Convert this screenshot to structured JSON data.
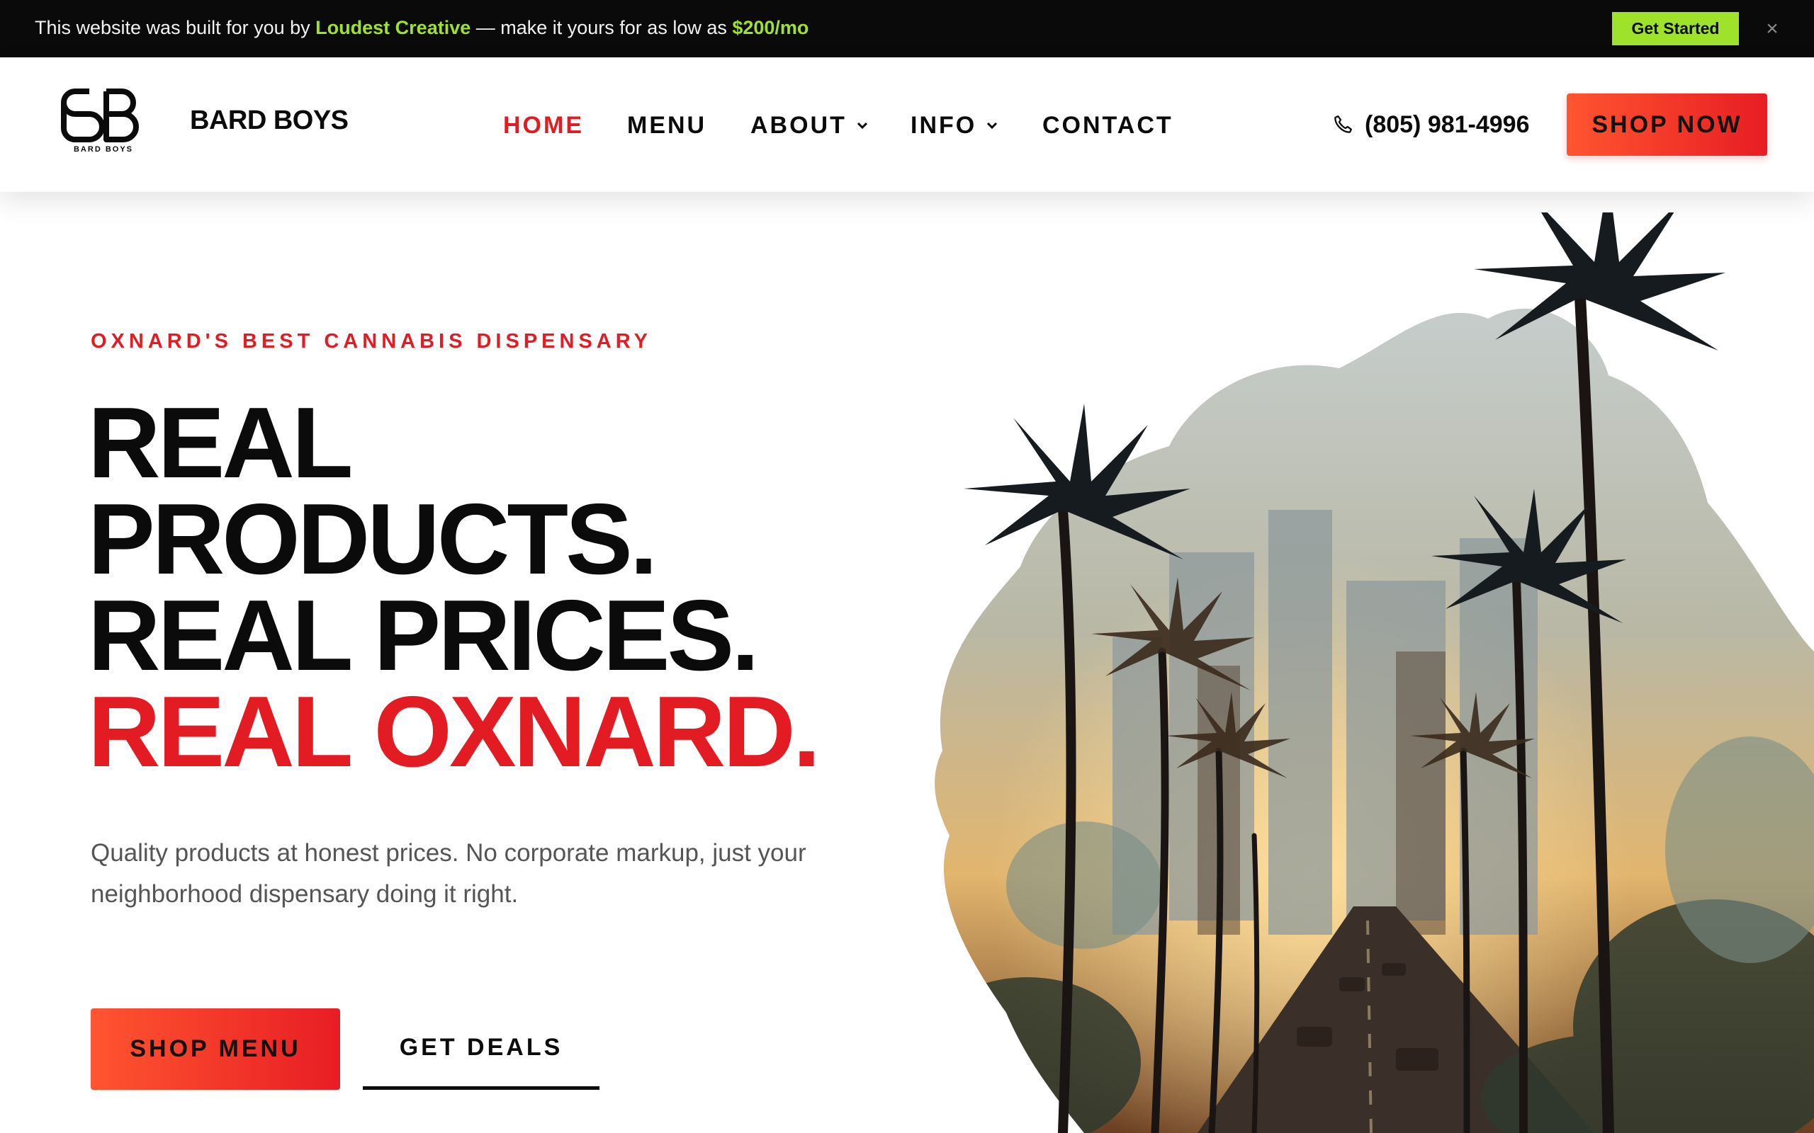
{
  "promo": {
    "text_before": "This website was built for you by ",
    "brand": "Loudest Creative",
    "text_middle": " — make it yours for as low as ",
    "price": "$200/mo",
    "cta_label": "Get Started",
    "close_label": "×"
  },
  "header": {
    "logo_mark": "BB",
    "logo_sub": "BARD BOYS",
    "brand": "BARD BOYS",
    "nav": [
      {
        "label": "HOME",
        "active": true
      },
      {
        "label": "MENU"
      },
      {
        "label": "ABOUT",
        "dropdown": true
      },
      {
        "label": "INFO",
        "dropdown": true
      },
      {
        "label": "CONTACT"
      }
    ],
    "phone": "(805) 981-4996",
    "shop_now": "SHOP NOW"
  },
  "hero": {
    "eyebrow": "OXNARD'S BEST CANNABIS DISPENSARY",
    "headline": [
      "REAL",
      "PRODUCTS.",
      "REAL PRICES."
    ],
    "headline_accent": "REAL OXNARD.",
    "subtext": "Quality products at honest prices. No corporate markup, just your neighborhood dispensary doing it right.",
    "primary_button": "SHOP MENU",
    "secondary_button": "GET DEALS"
  },
  "colors": {
    "accent": "#e31c24",
    "promo_accent": "#9ee22b",
    "promo_bg": "#0a0a0a",
    "button_gradient_start": "#ff5530",
    "button_gradient_end": "#e81d24"
  },
  "icons": [
    "phone-icon",
    "chevron-down-icon",
    "close-icon"
  ]
}
